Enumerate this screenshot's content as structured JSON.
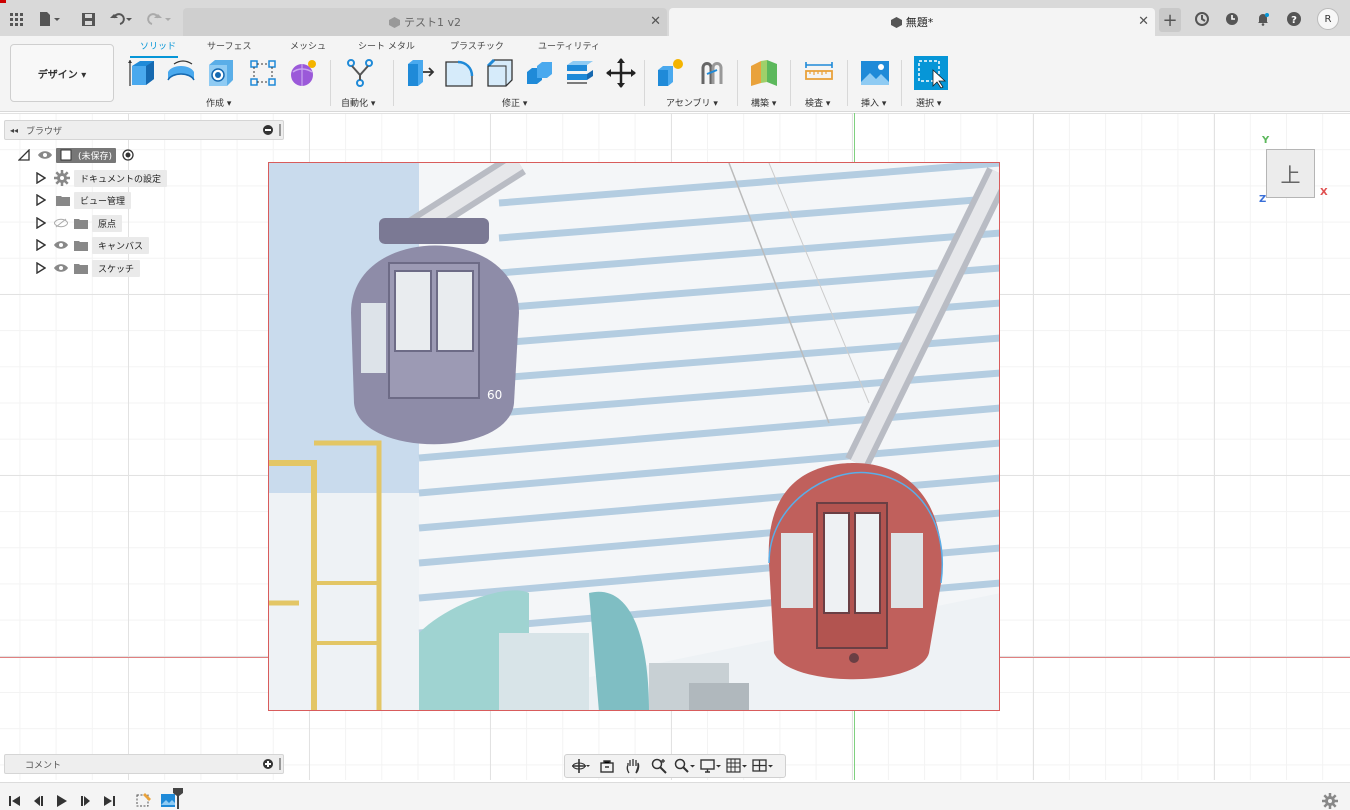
{
  "tabs": [
    {
      "label": "テスト1 v2",
      "active": false
    },
    {
      "label": "無題*",
      "active": true
    }
  ],
  "user_initial": "R",
  "workspace": {
    "label": "デザイン ▾"
  },
  "ribbon_tabs": [
    "ソリッド",
    "サーフェス",
    "メッシュ",
    "シート メタル",
    "プラスチック",
    "ユーティリティ"
  ],
  "ribbon_groups": [
    "作成 ▾",
    "自動化 ▾",
    "修正 ▾",
    "アセンブリ ▾",
    "構築 ▾",
    "検査 ▾",
    "挿入 ▾",
    "選択 ▾"
  ],
  "browser": {
    "title": "ブラウザ",
    "root": "(未保存)",
    "items": [
      "ドキュメントの設定",
      "ビュー管理",
      "原点",
      "キャンバス",
      "スケッチ"
    ]
  },
  "comments": {
    "title": "コメント"
  },
  "viewcube": {
    "face": "上",
    "x": "X",
    "y": "Y",
    "z": "Z"
  },
  "colors": {
    "accent": "#0696d7",
    "axis_x": "#e08080",
    "axis_y": "#7fd07f",
    "canvas_border": "#d85c5c"
  }
}
